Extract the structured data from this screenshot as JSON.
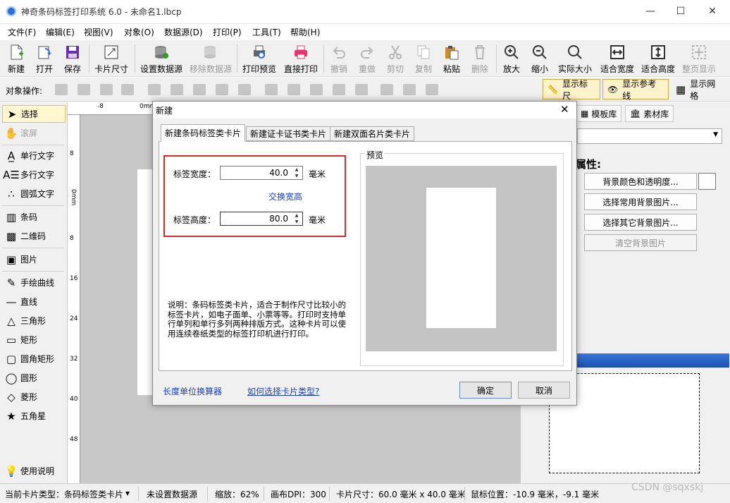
{
  "window": {
    "title": "神奇条码标签打印系统 6.0 - 未命名1.lbcp",
    "minimize": "—",
    "maximize": "☐",
    "close": "✕"
  },
  "menu": [
    "文件(F)",
    "编辑(E)",
    "视图(V)",
    "对象(O)",
    "数据源(D)",
    "打印(P)",
    "工具(T)",
    "帮助(H)"
  ],
  "toolbar": {
    "new": "新建",
    "open": "打开",
    "save": "保存",
    "card_size": "卡片尺寸",
    "set_datasource": "设置数据源",
    "remove_datasource": "移除数据源",
    "print_preview": "打印预览",
    "direct_print": "直接打印",
    "undo": "撤销",
    "redo": "重做",
    "cut": "剪切",
    "copy": "复制",
    "paste": "粘贴",
    "delete": "删除",
    "zoom_in": "放大",
    "zoom_out": "缩小",
    "actual_size": "实际大小",
    "fit_width": "适合宽度",
    "fit_height": "适合高度",
    "full_page": "整页显示"
  },
  "objbar": {
    "label": "对象操作:",
    "show_ruler": "显示标尺",
    "show_guides": "显示参考线",
    "show_grid": "显示网格"
  },
  "tools": {
    "select": "选择",
    "scroll": "滚屏",
    "single_text": "单行文字",
    "multi_text": "多行文字",
    "arc_text": "圆弧文字",
    "barcode": "条码",
    "qrcode": "二维码",
    "image": "图片",
    "freehand": "手绘曲线",
    "line": "直线",
    "triangle": "三角形",
    "rect": "矩形",
    "round_rect": "圆角矩形",
    "circle": "圆形",
    "diamond": "菱形",
    "star": "五角星",
    "help": "使用说明"
  },
  "ruler": {
    "top_marks": [
      "-8",
      "0mm"
    ],
    "left_marks": [
      "8",
      "0mm",
      "8",
      "16",
      "24",
      "32",
      "40",
      "48"
    ]
  },
  "right_panel": {
    "tab_templates": "模板库",
    "tab_materials": "素材库",
    "props_label": "属性:",
    "bg_color_btn": "背景颜色和透明度...",
    "common_bg_btn": "选择常用背景图片...",
    "other_bg_btn": "选择其它背景图片...",
    "clear_bg_btn": "清空背景图片"
  },
  "status": {
    "card_type": "当前卡片类型：条码标签类卡片",
    "datasource": "未设置数据源",
    "zoom": "缩放：62%",
    "dpi": "画布DPI：300",
    "card_size": "卡片尺寸：60.0 毫米 x 40.0 毫米",
    "mouse_pos": "鼠标位置：-10.9 毫米，-9.1 毫米"
  },
  "watermark": "CSDN @sqxskj",
  "dialog": {
    "title": "新建",
    "close": "✕",
    "tabs": [
      "新建条码标签类卡片",
      "新建证卡证书类卡片",
      "新建双面名片类卡片"
    ],
    "width_label": "标签宽度：",
    "width_value": "40.0",
    "height_label": "标签高度：",
    "height_value": "80.0",
    "unit": "毫米",
    "swap_link": "交换宽高",
    "preview_label": "预览",
    "preview_card": {
      "width_mm": 40.0,
      "height_mm": 80.0
    },
    "description": "说明：条码标签类卡片，适合于制作尺寸比较小的标签卡片，如电子面单、小票等等。打印时支持单行单列和单行多列两种排版方式。这种卡片可以使用连续卷纸类型的标签打印机进行打印。",
    "unit_converter_link": "长度单位换算器",
    "how_to_choose_link": "如何选择卡片类型?",
    "ok": "确定",
    "cancel": "取消"
  },
  "colors": {
    "accent_red": "#d62a2a",
    "link_blue": "#1a3fc1",
    "canvas_gray": "#c8c8c8",
    "selected_tool": "#fff7d0"
  }
}
